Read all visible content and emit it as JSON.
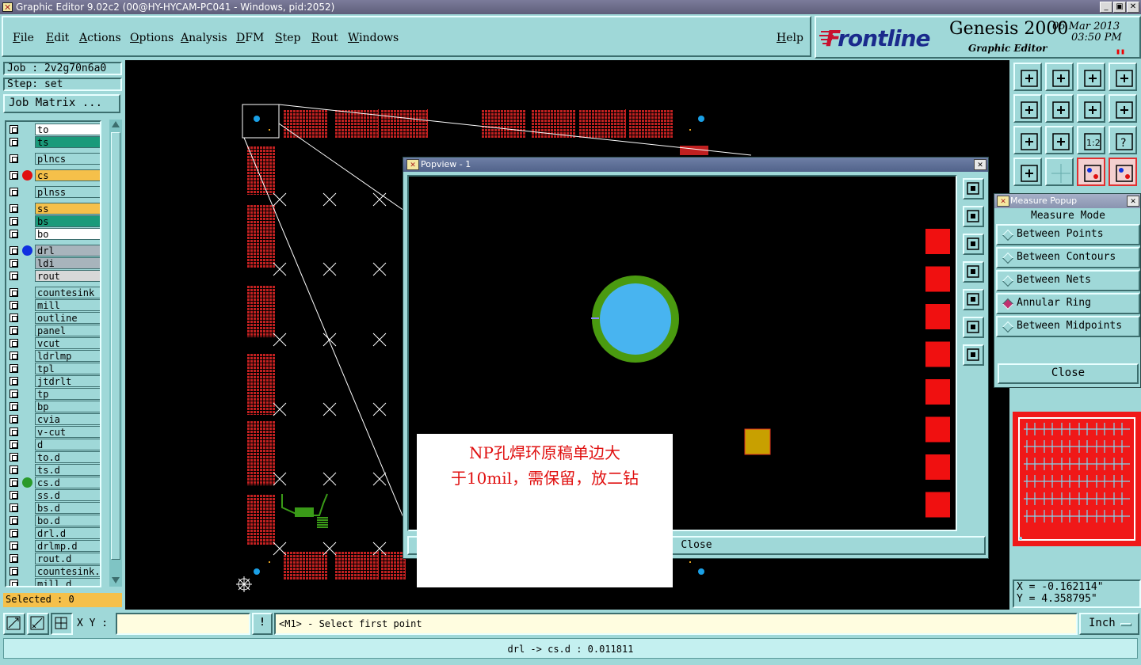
{
  "window": {
    "title": "Graphic Editor 9.02c2 (00@HY-HYCAM-PC041 - Windows, pid:2052)"
  },
  "menu": {
    "items": [
      "File",
      "Edit",
      "Actions",
      "Options",
      "Analysis",
      "DFM",
      "Step",
      "Rout",
      "Windows"
    ],
    "help": "Help"
  },
  "brand": {
    "logo_first": "F",
    "logo_rest": "rontline",
    "product": "Genesis 2000",
    "subtitle": "Graphic Editor",
    "date": "06 Mar 2013",
    "time": "03:50 PM"
  },
  "job": {
    "job_line": "Job : 2v2g70n6a0",
    "step_line": "Step: set",
    "job_matrix": "Job Matrix ..."
  },
  "layers": [
    {
      "name": "to",
      "color": "#ffffff"
    },
    {
      "name": "ts",
      "color": "#1a9a7a"
    },
    {
      "name": "plncs",
      "color": "#9fd8d8",
      "gap": true
    },
    {
      "name": "cs",
      "color": "#f5c04a",
      "gap": true,
      "dot": "#e01010",
      "active": true
    },
    {
      "name": "plnss",
      "color": "#9fd8d8",
      "gap": true
    },
    {
      "name": "ss",
      "color": "#f5c04a",
      "gap": true
    },
    {
      "name": "bs",
      "color": "#1a9a7a"
    },
    {
      "name": "bo",
      "color": "#ffffff"
    },
    {
      "name": "drl",
      "color": "#a8b4bc",
      "gap": true,
      "dot": "#1030e0"
    },
    {
      "name": "ldi",
      "color": "#a8b4bc"
    },
    {
      "name": "rout",
      "color": "#d8d8d8"
    },
    {
      "name": "countesink",
      "color": "#9fd8d8",
      "gap": true
    },
    {
      "name": "mill",
      "color": "#9fd8d8"
    },
    {
      "name": "outline",
      "color": "#9fd8d8"
    },
    {
      "name": "panel",
      "color": "#9fd8d8"
    },
    {
      "name": "vcut",
      "color": "#9fd8d8"
    },
    {
      "name": "ldrlmp",
      "color": "#9fd8d8"
    },
    {
      "name": "tpl",
      "color": "#9fd8d8"
    },
    {
      "name": "jtdrlt",
      "color": "#9fd8d8"
    },
    {
      "name": "tp",
      "color": "#9fd8d8"
    },
    {
      "name": "bp",
      "color": "#9fd8d8"
    },
    {
      "name": "cvia",
      "color": "#9fd8d8"
    },
    {
      "name": "v-cut",
      "color": "#9fd8d8"
    },
    {
      "name": "d",
      "color": "#9fd8d8"
    },
    {
      "name": "to.d",
      "color": "#9fd8d8"
    },
    {
      "name": "ts.d",
      "color": "#9fd8d8"
    },
    {
      "name": "cs.d",
      "color": "#9fd8d8",
      "dot": "#2a9a2a"
    },
    {
      "name": "ss.d",
      "color": "#9fd8d8"
    },
    {
      "name": "bs.d",
      "color": "#9fd8d8"
    },
    {
      "name": "bo.d",
      "color": "#9fd8d8"
    },
    {
      "name": "drl.d",
      "color": "#9fd8d8"
    },
    {
      "name": "drlmp.d",
      "color": "#9fd8d8"
    },
    {
      "name": "rout.d",
      "color": "#9fd8d8"
    },
    {
      "name": "countesink.d",
      "color": "#9fd8d8"
    },
    {
      "name": "mill.d",
      "color": "#9fd8d8"
    }
  ],
  "selected": "Selected : 0",
  "popview": {
    "title": "Popview - 1",
    "close_label": "Close"
  },
  "measure": {
    "title": "Measure Popup",
    "mode_label": "Measure Mode",
    "options": [
      "Between Points",
      "Between Contours",
      "Between Nets",
      "Annular Ring",
      "Between Midpoints"
    ],
    "selected_index": 3,
    "close_label": "Close"
  },
  "coords": {
    "x": "X = -0.162114\"",
    "y": "Y = 4.358795\""
  },
  "command": {
    "xy_label": "X Y :",
    "xy_value": "",
    "bang": "!",
    "prompt": "<M1> - Select first point",
    "unit": "Inch"
  },
  "status": "drl -> cs.d : 0.011811",
  "annotation": {
    "line1": "NP孔焊环原稿单边大",
    "line2": "于10mil，需保留，放二钻"
  },
  "colors": {
    "panel": "#9fd8d8",
    "copper": "#c02020",
    "ring": "#4a9a10",
    "hole": "#48b4f0",
    "accent": "#f5c04a"
  }
}
